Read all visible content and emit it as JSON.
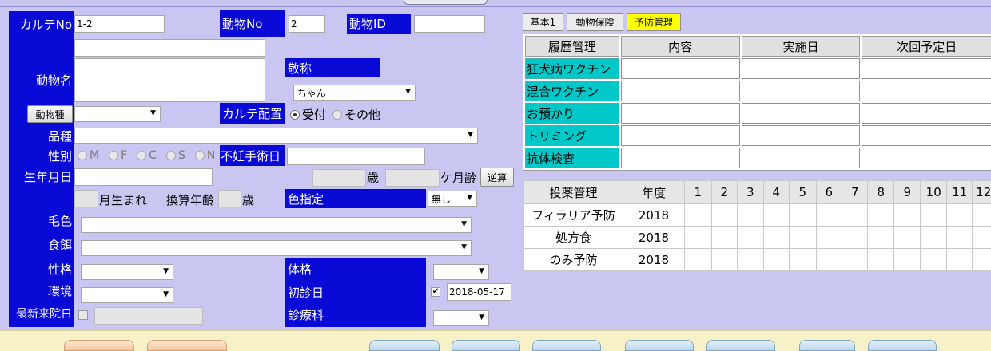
{
  "left": {
    "karte_no_label": "カルテNo",
    "karte_no_value": "1-2",
    "animal_no_label": "動物No",
    "animal_no_value": "2",
    "animal_id_label": "動物ID",
    "animal_id_value": "",
    "animal_name_label": "動物名",
    "honorific_label": "敬称",
    "honorific_value": "ちゃん",
    "species_button": "動物種",
    "karte_location_label": "カルテ配置",
    "karte_location_options": [
      "受付",
      "その他"
    ],
    "karte_location_selected": "受付",
    "breed_label": "品種",
    "sex_label": "性別",
    "sex_options": [
      "M",
      "F",
      "C",
      "S",
      "N"
    ],
    "sterilization_label": "不妊手術日",
    "birthdate_label": "生年月日",
    "age_years_unit": "歳",
    "age_months_unit": "ケ月齢",
    "reverse_calc_button": "逆算",
    "birth_month_suffix": "月生まれ",
    "converted_age_label": "換算年齢",
    "converted_age_unit": "歳",
    "color_spec_label": "色指定",
    "color_spec_value": "無し",
    "coat_label": "毛色",
    "food_label": "食餌",
    "personality_label": "性格",
    "physique_label": "体格",
    "environment_label": "環境",
    "first_visit_label": "初診日",
    "first_visit_checked": true,
    "first_visit_value": "2018-05-17",
    "latest_visit_label": "最新来院日",
    "department_label": "診療科"
  },
  "tabs": [
    {
      "label": "基本1",
      "active": false
    },
    {
      "label": "動物保険",
      "active": false
    },
    {
      "label": "予防管理",
      "active": true
    }
  ],
  "history": {
    "headers": [
      "履歴管理",
      "内容",
      "実施日",
      "次回予定日"
    ],
    "rows": [
      "狂犬病ワクチン",
      "混合ワクチン",
      "お預かり",
      "トリミング",
      "抗体検査"
    ]
  },
  "medication": {
    "headers": [
      "投薬管理",
      "年度",
      "1",
      "2",
      "3",
      "4",
      "5",
      "6",
      "7",
      "8",
      "9",
      "10",
      "11",
      "12"
    ],
    "rows": [
      {
        "name": "フィラリア予防",
        "year": "2018"
      },
      {
        "name": "処方食",
        "year": "2018"
      },
      {
        "name": "のみ予防",
        "year": "2018"
      }
    ]
  },
  "colors": {
    "label_blue": "#0a0ad6",
    "panel_lavender": "#c9c6f2",
    "history_row_cyan": "#00c8c8",
    "active_tab_yellow": "#ffff00"
  }
}
